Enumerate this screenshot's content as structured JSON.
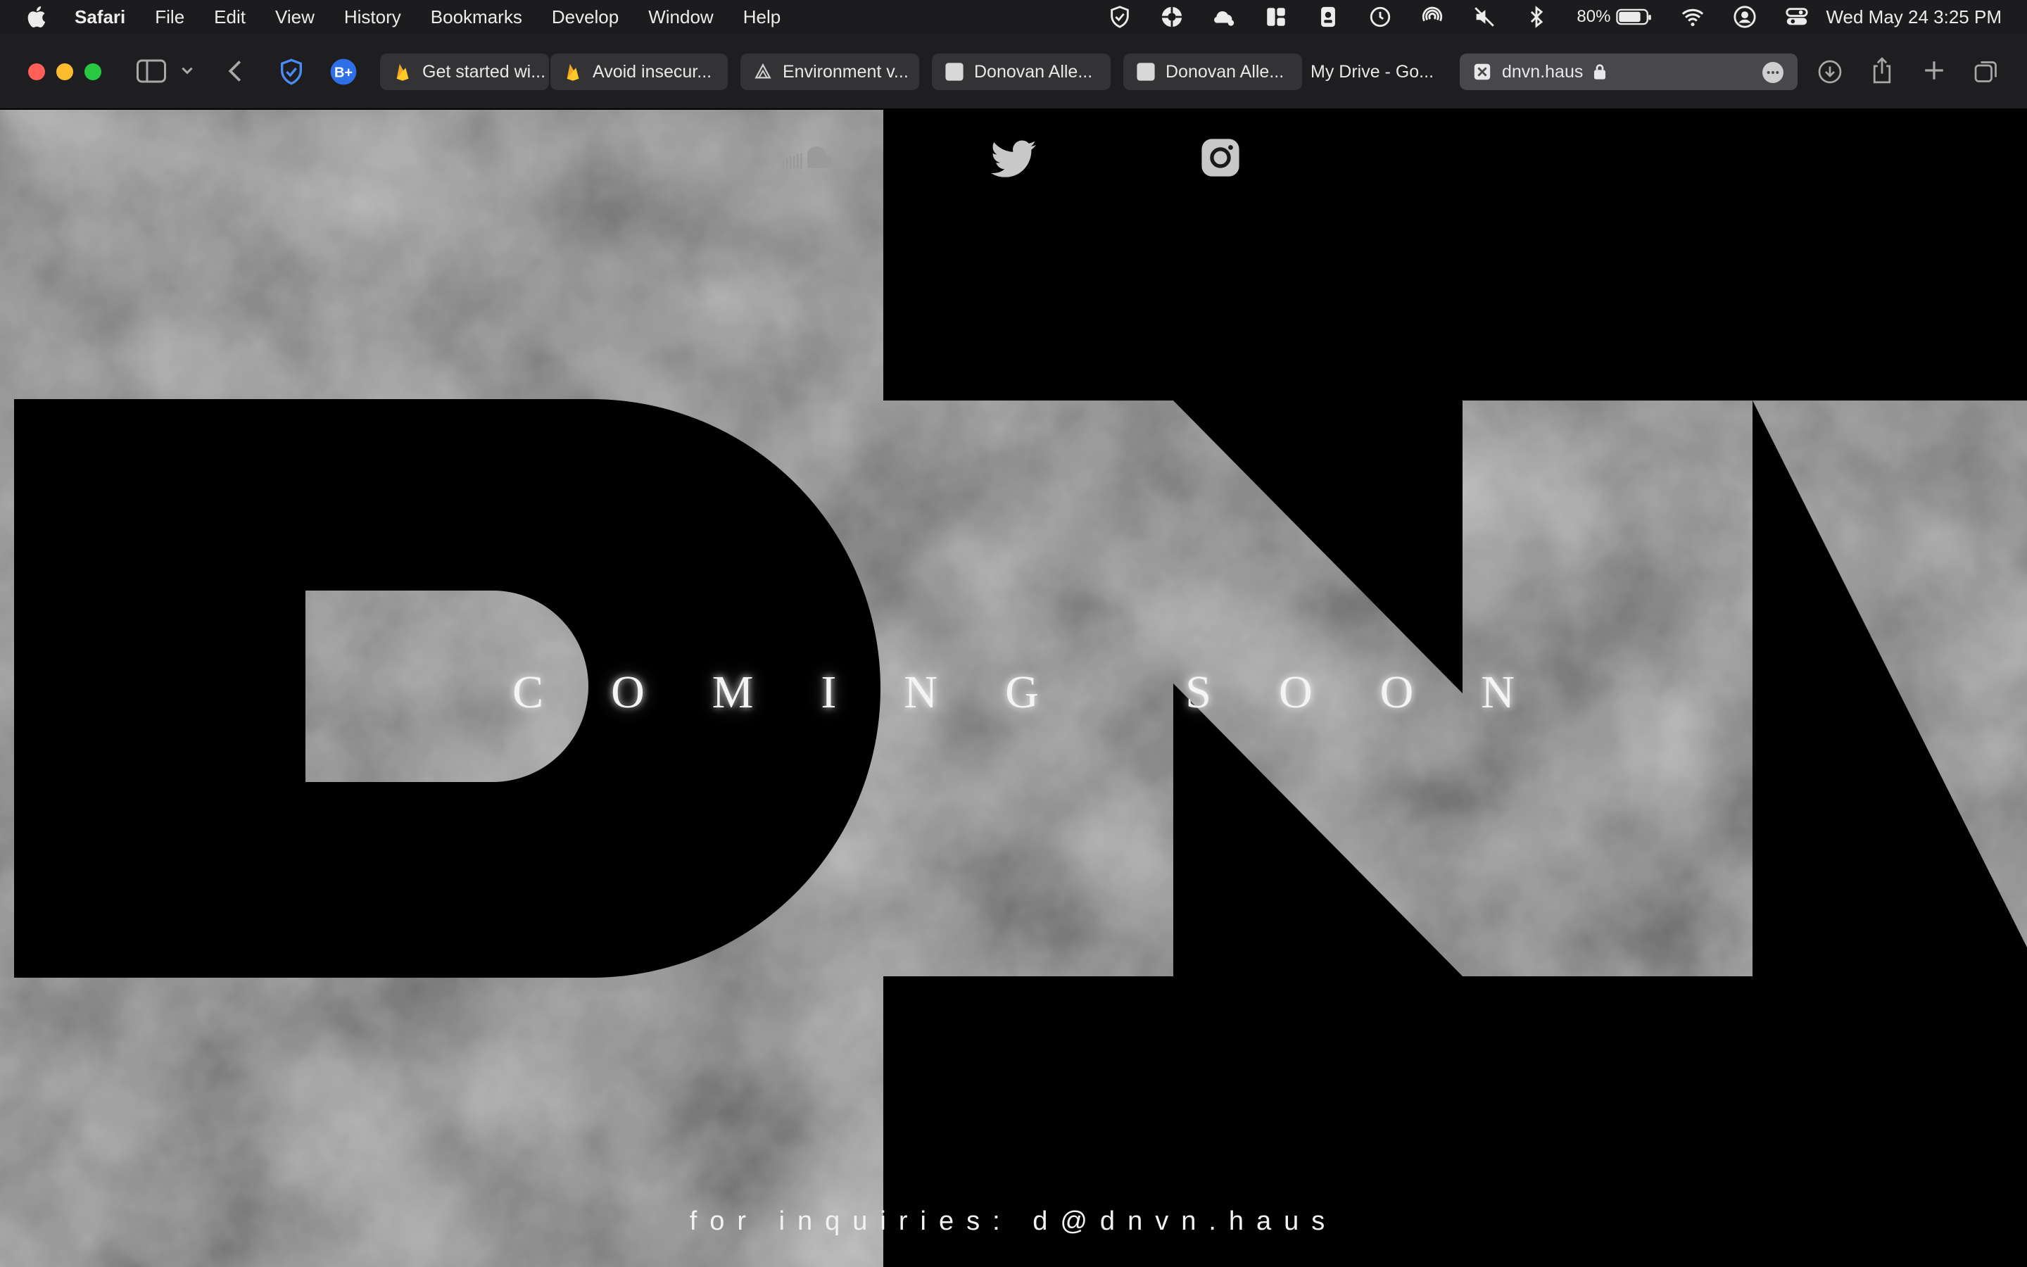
{
  "menubar": {
    "app_name": "Safari",
    "items": [
      "File",
      "Edit",
      "View",
      "History",
      "Bookmarks",
      "Develop",
      "Window",
      "Help"
    ],
    "battery_percent": "80%",
    "clock": "Wed May 24  3:25 PM",
    "status_icons": [
      "shield-icon",
      "aperture-icon",
      "weather-icon",
      "grid-icon",
      "contact-card-icon",
      "time-machine-icon",
      "airdrop-icon",
      "mute-icon",
      "bluetooth-icon",
      "battery-icon",
      "wifi-icon",
      "user-icon",
      "control-center-icon"
    ]
  },
  "toolbar": {
    "tabs": [
      {
        "title": "Get started wi...",
        "icon": "firebase-icon"
      },
      {
        "title": "Avoid insecur...",
        "icon": "firebase-icon"
      },
      {
        "title": "Environment v...",
        "icon": "vercel-icon"
      },
      {
        "title": "Donovan Alle...",
        "icon": "page-icon"
      },
      {
        "title": "Donovan Alle...",
        "icon": "page-icon"
      },
      {
        "title": "My Drive - Go...",
        "icon": "drive-icon"
      },
      {
        "title": "dnvn.haus",
        "icon": "close-tab-icon"
      }
    ],
    "active_tab_url": "dnvn.haus"
  },
  "page": {
    "logo_text": "DNV",
    "headline": "COMING SOON",
    "footer": "for inquiries: d@dnvn.haus",
    "social_links": [
      "soundcloud-icon",
      "twitter-icon",
      "instagram-icon"
    ],
    "colors": {
      "background": "#000000",
      "cloud": "#5a5a5a",
      "text": "#f4f4f4"
    }
  }
}
